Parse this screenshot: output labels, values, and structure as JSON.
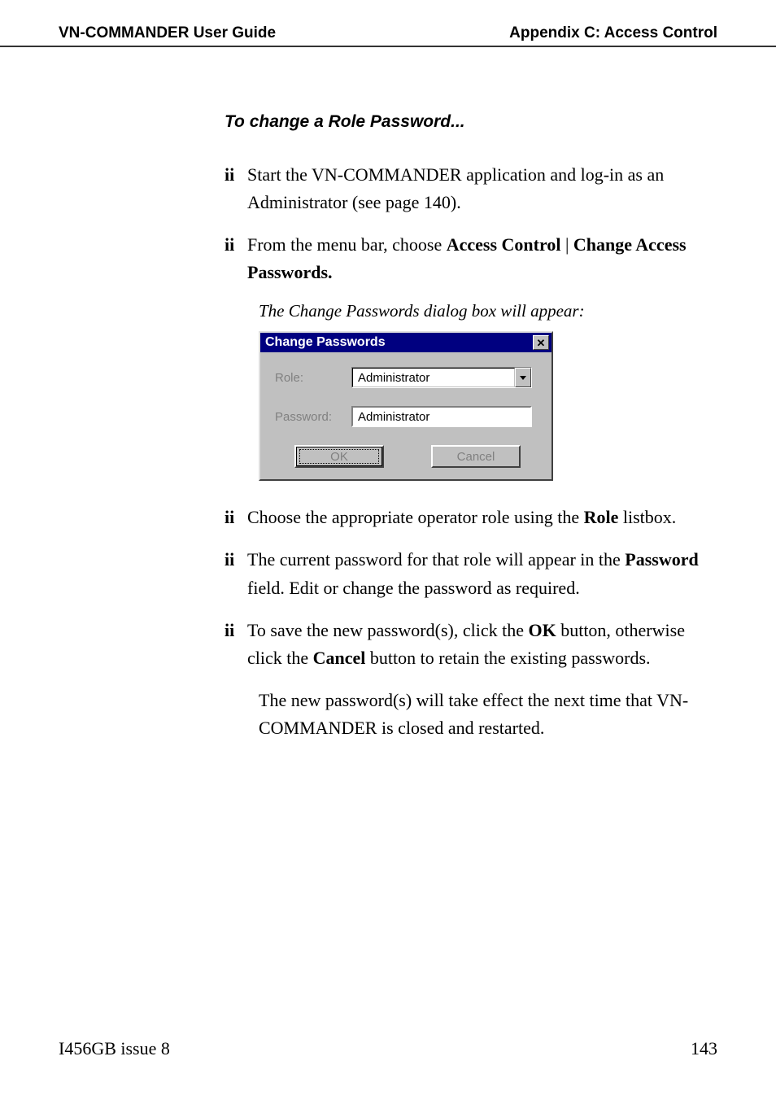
{
  "header": {
    "left": "VN-COMMANDER User Guide",
    "right": "Appendix C: Access Control"
  },
  "section": {
    "title": "To change a Role Password..."
  },
  "steps": {
    "bullet": "ii",
    "s1a": "Start the VN-COMMANDER application and log-in as an Administrator (see page 140).",
    "s2a": "From the menu bar, choose ",
    "s2b": "Access Control",
    "s2c": " | ",
    "s2d": "Change Access Passwords.",
    "caption": "The Change Passwords dialog box will appear:",
    "s3a": "Choose the appropriate operator role using the ",
    "s3b": "Role",
    "s3c": " listbox.",
    "s4a": "The current password for that role will appear in the ",
    "s4b": "Password",
    "s4c": " field. Edit or change the password as required.",
    "s5a": "To save the new password(s), click the ",
    "s5b": "OK",
    "s5c": " button, otherwise click the ",
    "s5d": "Cancel",
    "s5e": " button to retain the existing passwords.",
    "s5note": "The new password(s) will take effect the next time that VN-COMMANDER is closed and restarted."
  },
  "dialog": {
    "title": "Change Passwords",
    "close_glyph": "✕",
    "role_label": "Role:",
    "password_label": "Password:",
    "role_value": "Administrator",
    "password_value": "Administrator",
    "ok": "OK",
    "cancel": "Cancel"
  },
  "footer": {
    "left": "I456GB issue 8",
    "right": "143"
  }
}
